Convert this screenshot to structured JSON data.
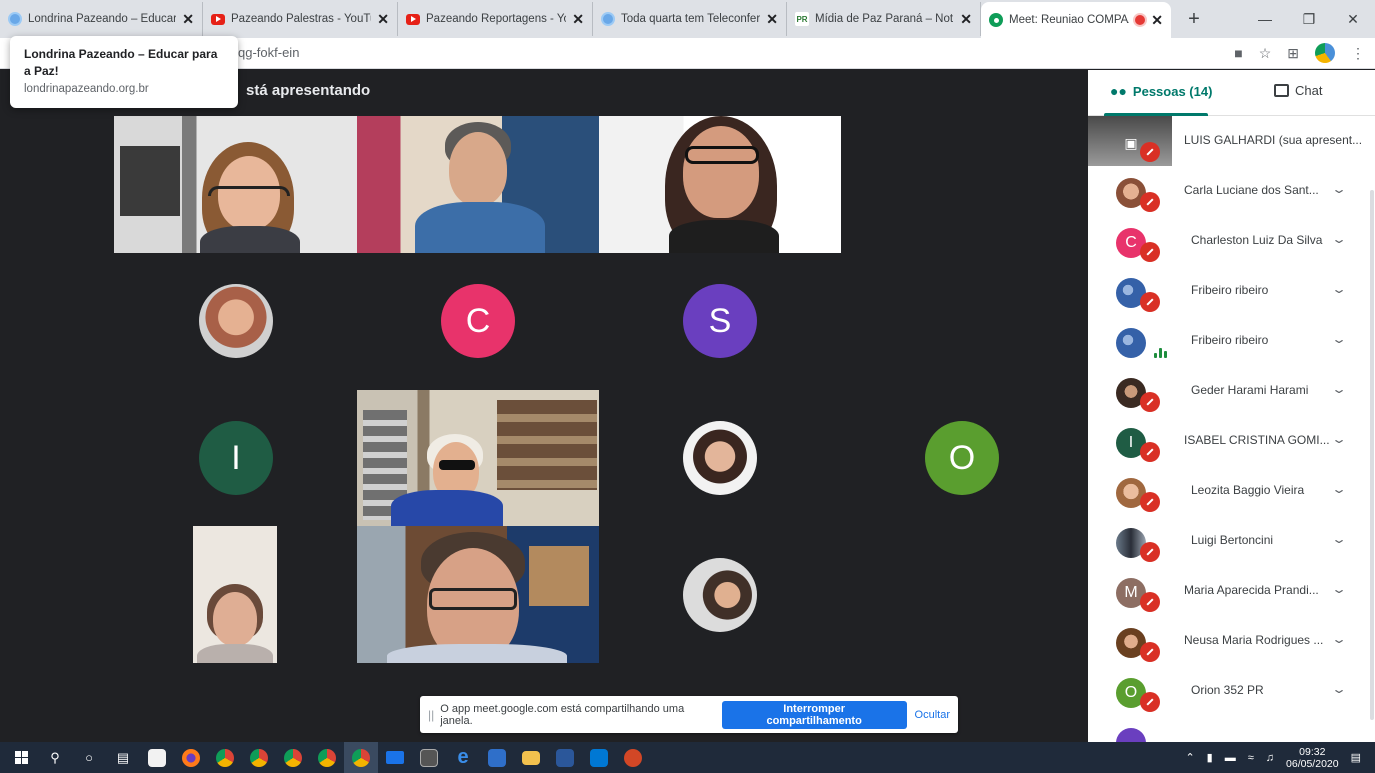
{
  "browser": {
    "tabs": [
      {
        "title": "Londrina Pazeando – Educar",
        "favicon": "londrina-favicon",
        "close": "✕"
      },
      {
        "title": "Pazeando Palestras - YouTub",
        "favicon": "youtube-icon",
        "close": "✕"
      },
      {
        "title": "Pazeando Reportagens - You",
        "favicon": "youtube-icon",
        "close": "✕"
      },
      {
        "title": "Toda quarta tem Teleconferê",
        "favicon": "londrina-favicon",
        "close": "✕"
      },
      {
        "title": "Mídia de Paz Paraná – Notíci",
        "favicon": "pr-favicon",
        "close": "✕"
      },
      {
        "title": "Meet: Reuniao COMPAZ",
        "favicon": "meet-icon",
        "close": "✕"
      }
    ],
    "new_tab": "+",
    "url_tail": "qg-fokf-ein",
    "tooltip": {
      "title": "Londrina Pazeando – Educar para a Paz!",
      "url": "londrinapazeando.org.br"
    }
  },
  "meet": {
    "presenting_label": "stá apresentando",
    "tiles": [
      {
        "kind": "avatar",
        "letter": "C",
        "color": "#e8336b"
      },
      {
        "kind": "avatar",
        "letter": "S",
        "color": "#6a3fbf"
      },
      {
        "kind": "avatar",
        "letter": "I",
        "color": "#1f5c44"
      },
      {
        "kind": "avatar",
        "letter": "O",
        "color": "#5a9e2f"
      }
    ],
    "share_bar": {
      "message": "O app meet.google.com está compartilhando uma janela.",
      "stop_label": "Interromper compartilhamento",
      "hide_label": "Ocultar"
    }
  },
  "panel": {
    "people_tab": "Pessoas (14)",
    "chat_tab": "Chat",
    "participants": [
      {
        "name": "LUIS GALHARDI (sua apresent...",
        "avatar": "screen",
        "status": "muted"
      },
      {
        "name": "Carla Luciane dos Sant...",
        "avatar": "photo",
        "color": "#b47a5a",
        "status": "muted"
      },
      {
        "name": "Charleston Luiz Da Silva",
        "avatar": "letter",
        "letter": "C",
        "color": "#e8336b",
        "status": "muted"
      },
      {
        "name": "Fribeiro ribeiro",
        "avatar": "photo",
        "color": "#3561a8",
        "status": "muted"
      },
      {
        "name": "Fribeiro ribeiro",
        "avatar": "photo",
        "color": "#3561a8",
        "status": "speaking"
      },
      {
        "name": "Geder Harami Harami",
        "avatar": "photo",
        "color": "#6b4a3a",
        "status": "muted"
      },
      {
        "name": "ISABEL CRISTINA GOMI...",
        "avatar": "letter",
        "letter": "I",
        "color": "#1f5c44",
        "status": "muted"
      },
      {
        "name": "Leozita Baggio Vieira",
        "avatar": "photo",
        "color": "#c08060",
        "status": "muted"
      },
      {
        "name": "Luigi Bertoncini",
        "avatar": "photo",
        "color": "#4a5060",
        "status": "muted"
      },
      {
        "name": "Maria Aparecida Prandi...",
        "avatar": "letter",
        "letter": "M",
        "color": "#8d6e63",
        "status": "muted"
      },
      {
        "name": "Neusa Maria Rodrigues ...",
        "avatar": "photo",
        "color": "#a0683f",
        "status": "muted"
      },
      {
        "name": "Orion 352 PR",
        "avatar": "letter",
        "letter": "O",
        "color": "#5a9e2f",
        "status": "muted"
      }
    ]
  },
  "taskbar": {
    "time": "09:32",
    "date": "06/05/2020"
  }
}
